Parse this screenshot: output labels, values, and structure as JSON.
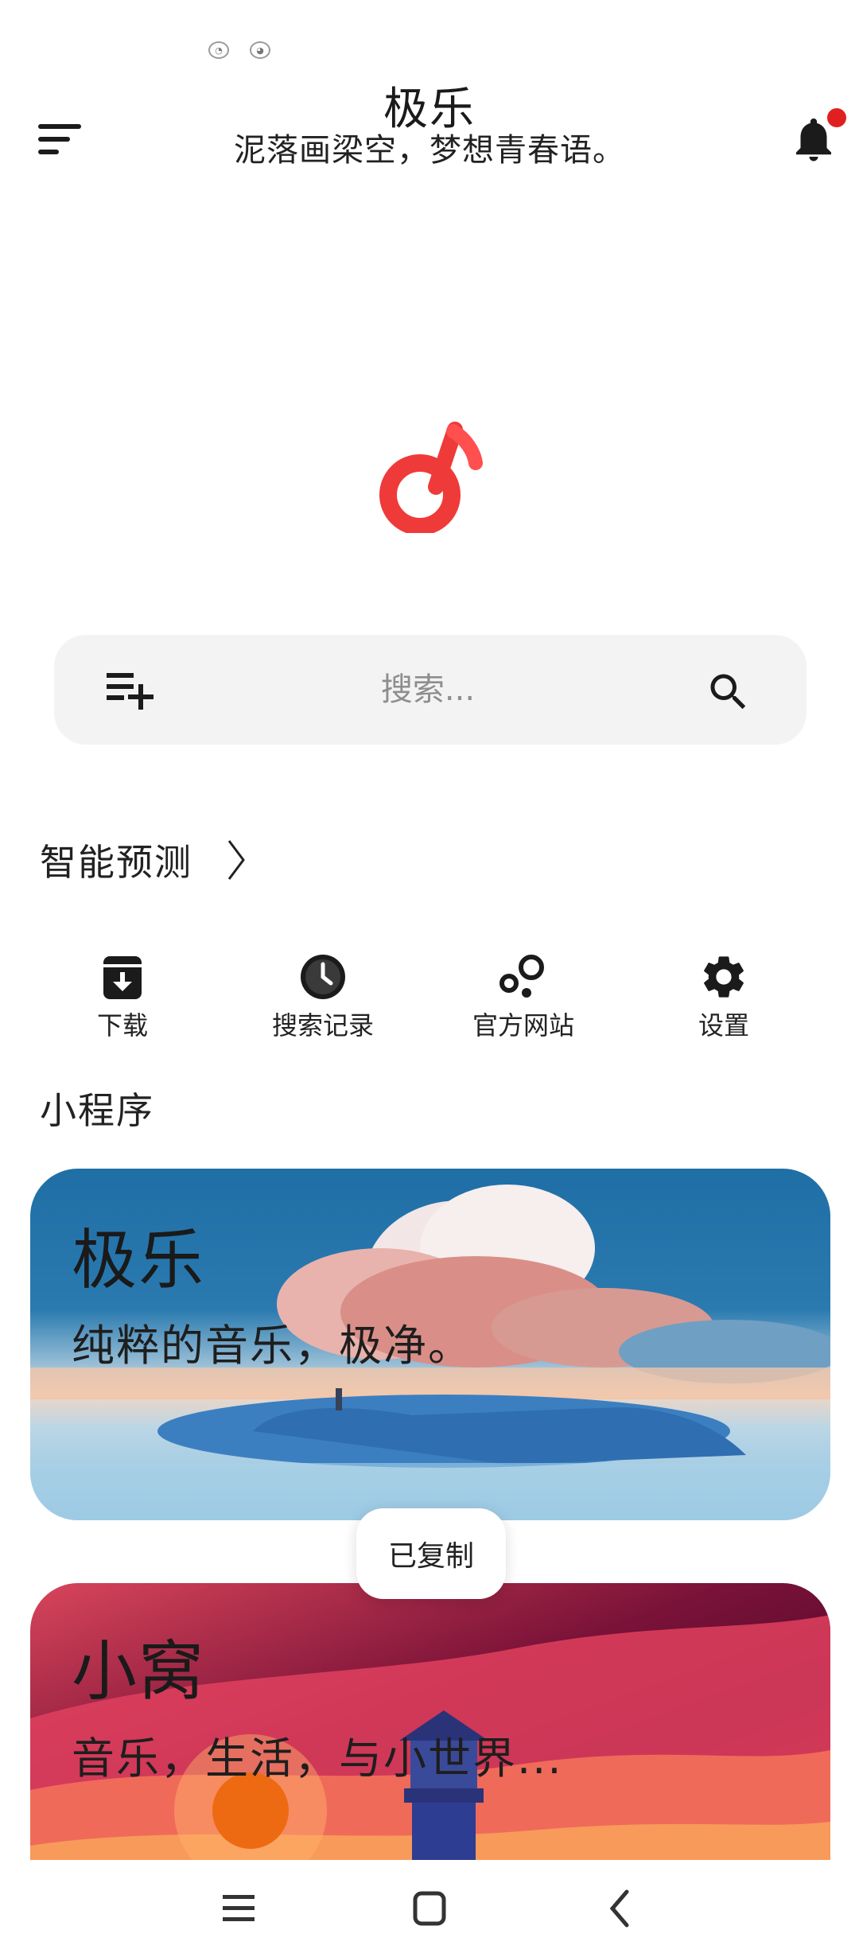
{
  "status": {
    "icon_1": "status-notification-icon",
    "icon_2": "status-notification-icon"
  },
  "header": {
    "title": "极乐",
    "subtitle": "泥落画梁空，梦想青春语。",
    "menu_icon": "menu-sort-icon",
    "bell_icon": "bell-icon",
    "has_unread": true
  },
  "logo": {
    "icon": "music-note-logo",
    "color": "#ef3a3a"
  },
  "search": {
    "placeholder": "搜索...",
    "left_icon": "playlist-add-icon",
    "right_icon": "search-icon"
  },
  "prediction": {
    "label": "智能预测",
    "chevron": "〉"
  },
  "quick_actions": [
    {
      "label": "下载",
      "icon": "download-box-icon"
    },
    {
      "label": "搜索记录",
      "icon": "clock-icon"
    },
    {
      "label": "官方网站",
      "icon": "bubbles-icon"
    },
    {
      "label": "设置",
      "icon": "gear-icon"
    }
  ],
  "mini_programs": {
    "section_title": "小程序",
    "cards": [
      {
        "title": "极乐",
        "desc": "纯粹的音乐，极净。"
      },
      {
        "title": "小窝",
        "desc": "音乐，生活，与小世界..."
      }
    ]
  },
  "toast": {
    "text": "已复制"
  },
  "nav": {
    "menu_icon": "recent-apps-icon",
    "home_icon": "home-icon",
    "back_icon": "back-icon"
  },
  "colors": {
    "accent": "#ef3a3a",
    "card1": "#1f6fa6",
    "card2": "#b2183f"
  }
}
